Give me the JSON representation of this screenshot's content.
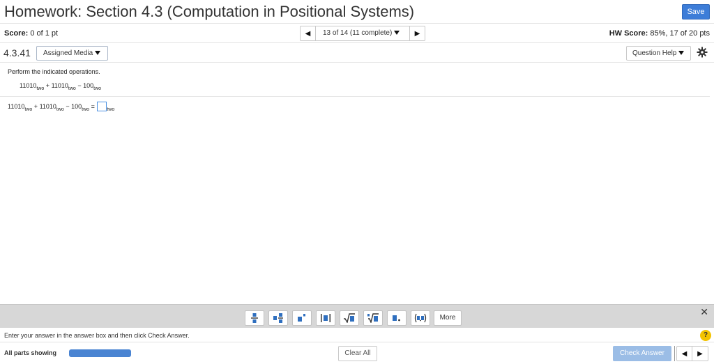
{
  "header": {
    "title": "Homework: Section 4.3 (Computation in Positional Systems)",
    "save_label": "Save"
  },
  "score": {
    "label": "Score:",
    "value": "0 of 1 pt"
  },
  "navigator": {
    "label": "13 of 14 (11 complete)",
    "prev_icon": "triangle-left",
    "next_icon": "triangle-right"
  },
  "hw_score": {
    "label": "HW Score:",
    "value": "85%, 17 of 20 pts"
  },
  "question": {
    "id": "4.3.41",
    "assigned_media_label": "Assigned Media",
    "help_label": "Question Help",
    "prompt": "Perform the indicated operations.",
    "operand1": "11010",
    "operand2": "11010",
    "operand3": "100",
    "base": "two",
    "plus": "+",
    "minus": "−",
    "equals": "="
  },
  "toolbar": {
    "more_label": "More",
    "tools": [
      "fraction",
      "mixed-number",
      "exponent",
      "absolute-value",
      "square-root",
      "nth-root",
      "decimal",
      "ordered-pair"
    ]
  },
  "instructions": "Enter your answer in the answer box and then click Check Answer.",
  "footer": {
    "parts_label": "All parts showing",
    "progress": 1.0,
    "clear_label": "Clear All",
    "check_label": "Check Answer"
  },
  "colors": {
    "accent": "#3d7dd8",
    "progress": "#4a84d2",
    "check_disabled": "#9bbde6",
    "help_yellow": "#f3c300"
  }
}
